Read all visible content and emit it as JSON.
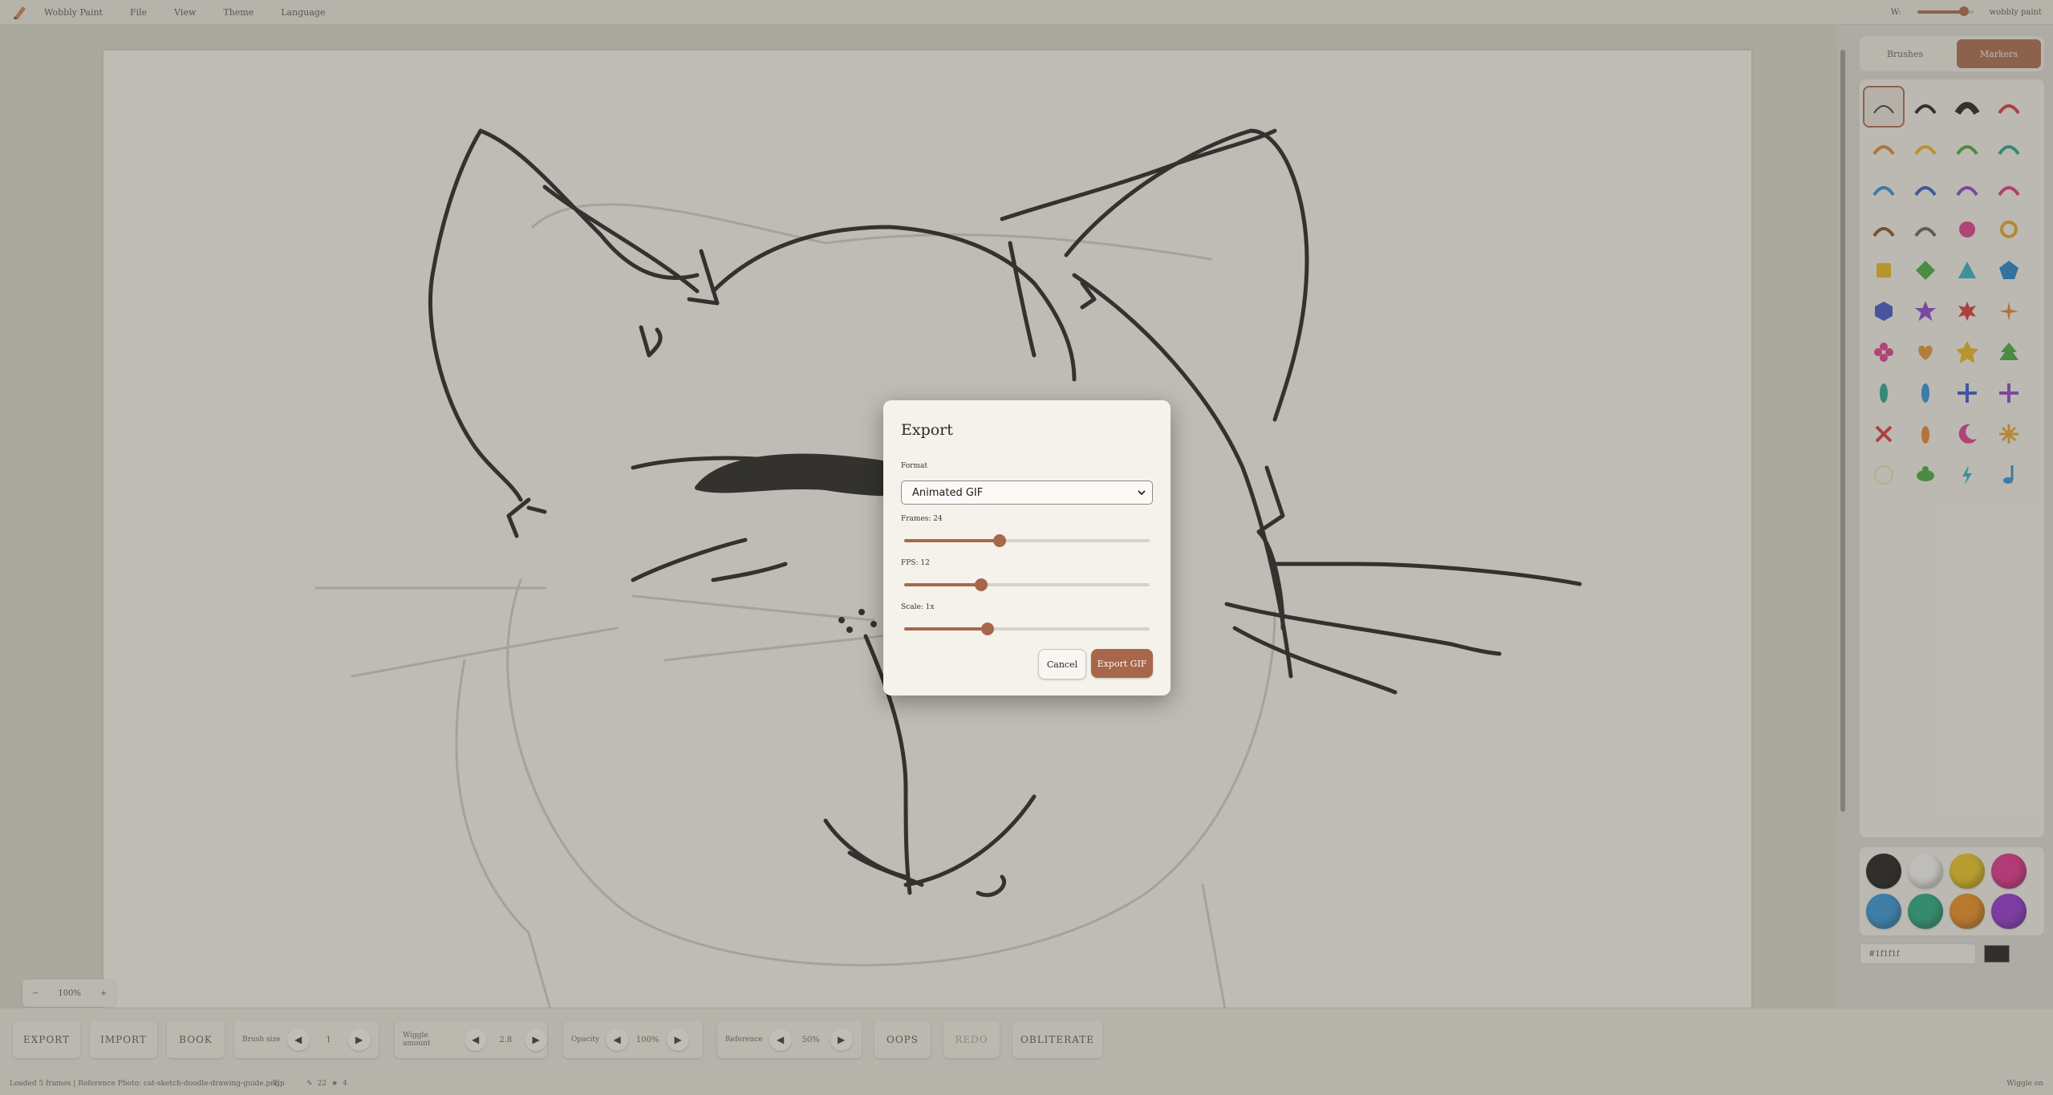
{
  "app": {
    "name": "Wobbly Paint",
    "menu": [
      "File",
      "View",
      "Theme",
      "Language"
    ],
    "menu_right_label": "W:",
    "brush_size_value": 0.85,
    "app_badge": "wobbly paint"
  },
  "panel": {
    "tabs": [
      {
        "label": "Brushes",
        "active": false
      },
      {
        "label": "Markers",
        "active": true
      }
    ],
    "swatch_colors": [
      "#1a1a1a",
      "#f4f4f4",
      "#e8c21e",
      "#de2c8a",
      "#2e93d6",
      "#21a77c",
      "#e68a1d",
      "#8f2fcf"
    ],
    "color_input": "#1f1f1f"
  },
  "toolbar": {
    "export": "EXPORT",
    "import": "IMPORT",
    "book": "BOOK",
    "brush_size_label": "Brush size",
    "brush_size_value": "1",
    "wiggle_label": "Wiggle amount",
    "wiggle_value": "2.8",
    "opacity_label": "Opacity",
    "opacity_value": "100%",
    "reference_label": "Reference",
    "reference_value": "50%",
    "oops": "OOPS",
    "redo": "REDO",
    "obliterate": "OBLITERATE"
  },
  "canvas": {
    "zoom_out": "−",
    "zoom_value": "100%",
    "zoom_in": "+"
  },
  "statusbar": {
    "main": "Loaded 5 frames | Reference Photo: cat-sketch-doodle-drawing-guide.png",
    "mid": "Tip",
    "tool_count": "22",
    "layer_count": "4",
    "right": "Wiggle on"
  },
  "dialog": {
    "title": "Export",
    "format_label": "Format",
    "format_value": "Animated GIF",
    "frames_label": "Frames: 24",
    "frames_value": 24,
    "frames_range": [
      1,
      60
    ],
    "fps_label": "FPS: 12",
    "fps_value": 12,
    "fps_range": [
      1,
      36
    ],
    "scale_label": "Scale: 1x",
    "scale_fraction": 0.34,
    "cancel": "Cancel",
    "export": "Export GIF"
  }
}
